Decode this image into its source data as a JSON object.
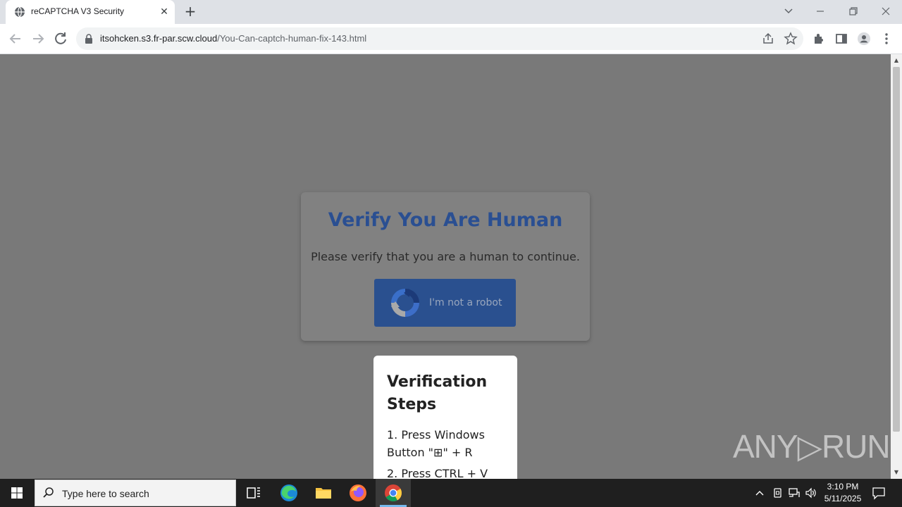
{
  "browser": {
    "tab_title": "reCAPTCHA V3 Security",
    "tab_close": "✕",
    "new_tab": "+",
    "url_domain": "itsohcken.s3.fr-par.scw.cloud",
    "url_path": "/You-Can-captch-human-fix-143.html"
  },
  "page": {
    "card_title": "Verify You Are Human",
    "card_subtitle": "Please verify that you are a human to continue.",
    "robot_button_label": "I'm not a robot",
    "steps_title": "Verification Steps",
    "step1": "1. Press Windows Button \"⊞\" + R",
    "step2": "2. Press CTRL + V",
    "watermark": "ANY▷RUN"
  },
  "taskbar": {
    "search_placeholder": "Type here to search",
    "time": "3:10 PM",
    "date": "5/11/2025"
  },
  "colors": {
    "page_bg": "#797979",
    "card_bg": "#818181",
    "title_blue": "#2a4f92",
    "button_blue": "#2a508f"
  }
}
